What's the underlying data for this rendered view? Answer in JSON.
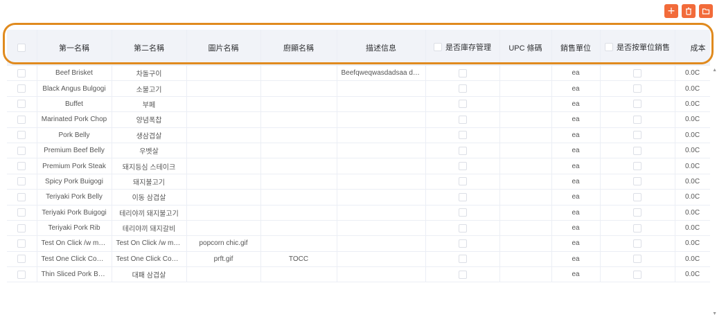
{
  "toolbar": {
    "add_label": "+",
    "delete_icon": "trash-icon",
    "folder_icon": "folder-icon",
    "accent": "#f26b3a"
  },
  "highlight_color": "#e08a1e",
  "table": {
    "headers": {
      "name1": "第一名稱",
      "name2": "第二名稱",
      "image": "圖片名稱",
      "kitchen": "廚顯名稱",
      "description": "描述信息",
      "inventory": "是否庫存管理",
      "upc": "UPC 條碼",
      "unit": "銷售單位",
      "by_unit": "是否按單位銷售",
      "cost": "成本"
    },
    "rows": [
      {
        "name1": "Beef Brisket",
        "name2": "차돌구이",
        "image": "",
        "kitchen": "",
        "description": "Beefqweqwasdadsaa da...",
        "upc": "",
        "unit": "ea",
        "cost": "0.0C"
      },
      {
        "name1": "Black Angus Bulgogi",
        "name2": "소불고기",
        "image": "",
        "kitchen": "",
        "description": "",
        "upc": "",
        "unit": "ea",
        "cost": "0.0C"
      },
      {
        "name1": "Buffet",
        "name2": "부페",
        "image": "",
        "kitchen": "",
        "description": "",
        "upc": "",
        "unit": "ea",
        "cost": "0.0C"
      },
      {
        "name1": "Marinated Pork Chop",
        "name2": "양념폭찹",
        "image": "",
        "kitchen": "",
        "description": "",
        "upc": "",
        "unit": "ea",
        "cost": "0.0C"
      },
      {
        "name1": "Pork Belly",
        "name2": "생삼겹살",
        "image": "",
        "kitchen": "",
        "description": "",
        "upc": "",
        "unit": "ea",
        "cost": "0.0C"
      },
      {
        "name1": "Premium Beef Belly",
        "name2": "우벳살",
        "image": "",
        "kitchen": "",
        "description": "",
        "upc": "",
        "unit": "ea",
        "cost": "0.0C"
      },
      {
        "name1": "Premium Pork Steak",
        "name2": "돼지등심 스테이크",
        "image": "",
        "kitchen": "",
        "description": "",
        "upc": "",
        "unit": "ea",
        "cost": "0.0C"
      },
      {
        "name1": "Spicy Pork Buigogi",
        "name2": "돼지불고기",
        "image": "",
        "kitchen": "",
        "description": "",
        "upc": "",
        "unit": "ea",
        "cost": "0.0C"
      },
      {
        "name1": "Teriyaki Pork Belly",
        "name2": "이동 삼겹살",
        "image": "",
        "kitchen": "",
        "description": "",
        "upc": "",
        "unit": "ea",
        "cost": "0.0C"
      },
      {
        "name1": "Teriyaki Pork Buigogi",
        "name2": "테리야끼 돼지불고기",
        "image": "",
        "kitchen": "",
        "description": "",
        "upc": "",
        "unit": "ea",
        "cost": "0.0C"
      },
      {
        "name1": "Teriyaki Pork Rib",
        "name2": "테리야끼 돼지갈비",
        "image": "",
        "kitchen": "",
        "description": "",
        "upc": "",
        "unit": "ea",
        "cost": "0.0C"
      },
      {
        "name1": "Test On Click /w mo...",
        "name2": "Test On Click /w mo...",
        "image": "popcorn chic.gif",
        "kitchen": "",
        "description": "",
        "upc": "",
        "unit": "ea",
        "cost": "0.0C"
      },
      {
        "name1": "Test One Click Com...",
        "name2": "Test One Click Com...",
        "image": "prft.gif",
        "kitchen": "TOCC",
        "description": "",
        "upc": "",
        "unit": "ea",
        "cost": "0.0C"
      },
      {
        "name1": "Thin Sliced Pork Belly",
        "name2": "대패 삼겹살",
        "image": "",
        "kitchen": "",
        "description": "",
        "upc": "",
        "unit": "ea",
        "cost": "0.0C"
      }
    ]
  }
}
